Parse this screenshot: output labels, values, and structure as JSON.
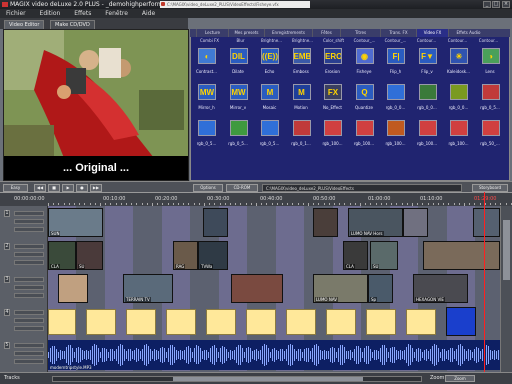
{
  "window": {
    "title": "MAGIX video deLuxe 2.0 PLUS - _demohighperformance.MVD",
    "url": "C:\\MAGIX\\video_deLuxe2_PLUS\\VideoEffects\\Fisheye.vfx",
    "controls": [
      "_",
      "□",
      "×"
    ]
  },
  "menu": [
    "Fichier",
    "Edition",
    "Effets",
    "Fenêtre",
    "Aide"
  ],
  "tabs": [
    "Video Editor",
    "Make CD/DVD"
  ],
  "preview": {
    "caption": "... Original ..."
  },
  "fx": {
    "tabs": [
      "Lecture",
      "Mes presets",
      "Enregistrements",
      "Fêtes",
      "Titres",
      "Trans. FX",
      "Video FX",
      "Effets Audio"
    ],
    "header_labels": [
      "Combi FX",
      "Blur",
      "Brightne...",
      "Brightne...",
      "Color_shift",
      "Contour_...",
      "Contour_...",
      "Contour...",
      "Contour...",
      "Contour..."
    ],
    "rows": [
      [
        {
          "label": "Contrast...",
          "glyph": "◐",
          "color": "#3f7ad4"
        },
        {
          "label": "Dilate",
          "glyph": "DIL",
          "color": "#2a5cc0"
        },
        {
          "label": "Echo",
          "glyph": "((E))",
          "color": "#2a5cc0"
        },
        {
          "label": "Emboss",
          "glyph": "EMB",
          "color": "#3a5aa8"
        },
        {
          "label": "Erosion",
          "glyph": "ERO",
          "color": "#2a3f90"
        },
        {
          "label": "Fisheye",
          "glyph": "◉",
          "color": "#4f6bd0"
        },
        {
          "label": "Flip_h",
          "glyph": "F|",
          "color": "#2a5cc0"
        },
        {
          "label": "Flip_v",
          "glyph": "F▼",
          "color": "#2a5cc0"
        },
        {
          "label": "Kaleidosk...",
          "glyph": "✳",
          "color": "#2f53b0"
        },
        {
          "label": "Lens",
          "glyph": "◑",
          "color": "#4aa05a"
        }
      ],
      [
        {
          "label": "Mirror_h",
          "glyph": "MW",
          "color": "#2a5cc0"
        },
        {
          "label": "Mirror_v",
          "glyph": "MW",
          "color": "#2a5cc0"
        },
        {
          "label": "Mosaic",
          "glyph": "M",
          "color": "#2a5cc0"
        },
        {
          "label": "Motion",
          "glyph": "M",
          "color": "#1f3f9a"
        },
        {
          "label": "No_Effect",
          "glyph": "FX",
          "color": "#3a3f60"
        },
        {
          "label": "Quantize",
          "glyph": "Q",
          "color": "#2a5cc0"
        },
        {
          "label": "rgb_0_0...",
          "glyph": "",
          "color": "#2f6fd8"
        },
        {
          "label": "rgb_0_0...",
          "glyph": "",
          "color": "#3a7a3a"
        },
        {
          "label": "rgb_0_0...",
          "glyph": "",
          "color": "#7a9a20"
        },
        {
          "label": "rgb_0_5...",
          "glyph": "",
          "color": "#c03a3a"
        }
      ],
      [
        {
          "label": "rgb_0_5...",
          "glyph": "",
          "color": "#2f6fd8"
        },
        {
          "label": "rgb_0_5...",
          "glyph": "",
          "color": "#3f9a3f"
        },
        {
          "label": "rgb_0_5...",
          "glyph": "",
          "color": "#2f6fd8"
        },
        {
          "label": "rgb_0_1...",
          "glyph": "",
          "color": "#c03a3a"
        },
        {
          "label": "rgb_100...",
          "glyph": "",
          "color": "#d04040"
        },
        {
          "label": "rgb_100...",
          "glyph": "",
          "color": "#d04040"
        },
        {
          "label": "rgb_100...",
          "glyph": "",
          "color": "#c05a20"
        },
        {
          "label": "rgb_100...",
          "glyph": "",
          "color": "#d04040"
        },
        {
          "label": "rgb_100...",
          "glyph": "",
          "color": "#d04040"
        },
        {
          "label": "rgb_50_...",
          "glyph": "",
          "color": "#d04040"
        }
      ]
    ]
  },
  "controls": {
    "options_label": "Options",
    "cdrom_label": "CD-ROM",
    "path": "C:\\MAGIX\\video_deLuxe2_PLUS\\VideoEffects",
    "storyboard_label": "Storyboard",
    "easy_label": "Easy"
  },
  "timeline": {
    "current_time": "00:00:00:00",
    "marks": [
      "00:10:00",
      "00:20:00",
      "00:30:00",
      "00:40:00",
      "00:50:00",
      "01:00:00",
      "01:10:00",
      "01:20:00"
    ],
    "end_time": "01:29:00",
    "tracks": [
      {
        "num": "1",
        "clips": [
          {
            "name": "SUN",
            "start": 0,
            "end": 55,
            "color": "#6a7b8a"
          },
          {
            "name": "",
            "start": 155,
            "end": 180,
            "color": "#3e4a5a"
          },
          {
            "name": "",
            "start": 265,
            "end": 290,
            "color": "#4a3e3a"
          },
          {
            "name": "LUMO NAV Hors",
            "start": 300,
            "end": 355,
            "color": "#4a5560"
          },
          {
            "name": "",
            "start": 355,
            "end": 380,
            "color": "#707080"
          },
          {
            "name": "",
            "start": 425,
            "end": 452,
            "color": "#556070"
          }
        ]
      },
      {
        "num": "2",
        "clips": [
          {
            "name": "CLA",
            "start": 0,
            "end": 28,
            "color": "#3a4a3a"
          },
          {
            "name": "SU",
            "start": 28,
            "end": 55,
            "color": "#4a3a3a"
          },
          {
            "name": "RAG",
            "start": 125,
            "end": 150,
            "color": "#6a5a4a"
          },
          {
            "name": "TVWa",
            "start": 150,
            "end": 180,
            "color": "#2f3a45"
          },
          {
            "name": "CLA",
            "start": 295,
            "end": 320,
            "color": "#3a3a3a"
          },
          {
            "name": "SU",
            "start": 322,
            "end": 350,
            "color": "#5a6a6a"
          },
          {
            "name": "",
            "start": 375,
            "end": 452,
            "color": "#7a6a5a"
          }
        ]
      },
      {
        "num": "3",
        "clips": [
          {
            "name": "",
            "start": 10,
            "end": 40,
            "color": "#c0a080"
          },
          {
            "name": "TERRAIN TV",
            "start": 75,
            "end": 125,
            "color": "#5a6a7a"
          },
          {
            "name": "",
            "start": 183,
            "end": 235,
            "color": "#7a4a40"
          },
          {
            "name": "LUMO NAV",
            "start": 265,
            "end": 320,
            "color": "#7a7a6a"
          },
          {
            "name": "Sp",
            "start": 320,
            "end": 345,
            "color": "#4a5a6a"
          },
          {
            "name": "HEXAGON VIE",
            "start": 365,
            "end": 420,
            "color": "#4a4a50"
          }
        ]
      },
      {
        "num": "4",
        "clips": [
          {
            "start": 0,
            "end": 28,
            "color": "#ffe89a"
          },
          {
            "start": 38,
            "end": 68,
            "color": "#ffe89a"
          },
          {
            "start": 78,
            "end": 108,
            "color": "#ffe89a"
          },
          {
            "start": 118,
            "end": 148,
            "color": "#ffe89a"
          },
          {
            "start": 158,
            "end": 188,
            "color": "#ffe89a"
          },
          {
            "start": 198,
            "end": 228,
            "color": "#ffe89a"
          },
          {
            "start": 238,
            "end": 268,
            "color": "#ffe89a"
          },
          {
            "start": 278,
            "end": 308,
            "color": "#ffe89a"
          },
          {
            "start": 318,
            "end": 348,
            "color": "#ffe89a"
          },
          {
            "start": 358,
            "end": 388,
            "color": "#ffe89a"
          },
          {
            "start": 398,
            "end": 428,
            "color": "#1a3fcc"
          }
        ]
      },
      {
        "num": "5",
        "audio": "moderntripstyle.MP3"
      }
    ]
  },
  "status": {
    "left": "Tracks",
    "zoom_label": "Zoom"
  }
}
